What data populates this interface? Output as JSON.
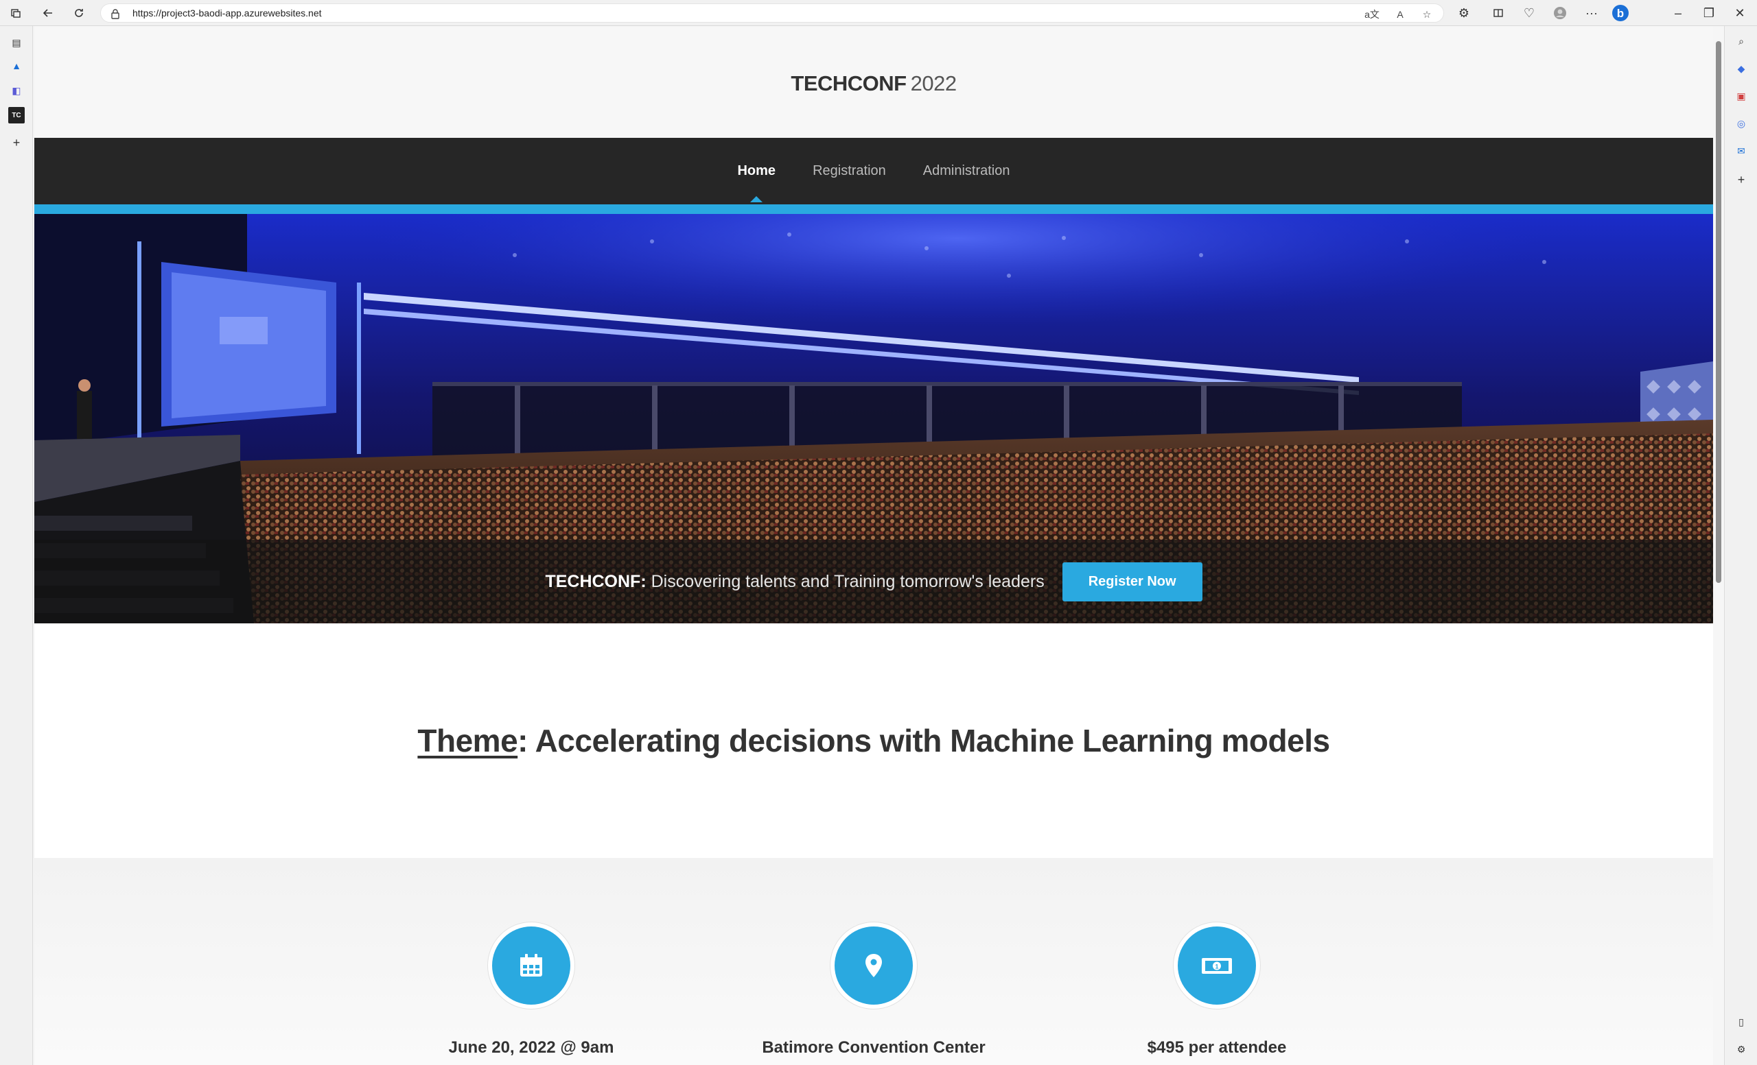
{
  "browser": {
    "url": "https://project3-baodi-app.azurewebsites.net"
  },
  "site": {
    "brand": "TECHCONF",
    "year": "2022"
  },
  "nav": {
    "items": [
      {
        "label": "Home",
        "active": true
      },
      {
        "label": "Registration",
        "active": false
      },
      {
        "label": "Administration",
        "active": false
      }
    ]
  },
  "hero": {
    "brand": "TECHCONF:",
    "tagline": "Discovering talents and Training tomorrow's leaders",
    "cta": "Register Now"
  },
  "theme": {
    "label": "Theme",
    "text": ": Accelerating decisions with Machine Learning models"
  },
  "features": [
    {
      "icon": "calendar-icon",
      "text": "June 20, 2022 @ 9am"
    },
    {
      "icon": "map-pin-icon",
      "text": "Batimore Convention Center"
    },
    {
      "icon": "money-icon",
      "text": "$495 per attendee"
    }
  ],
  "colors": {
    "accent": "#2aa9e0",
    "nav_bg": "#262626"
  }
}
